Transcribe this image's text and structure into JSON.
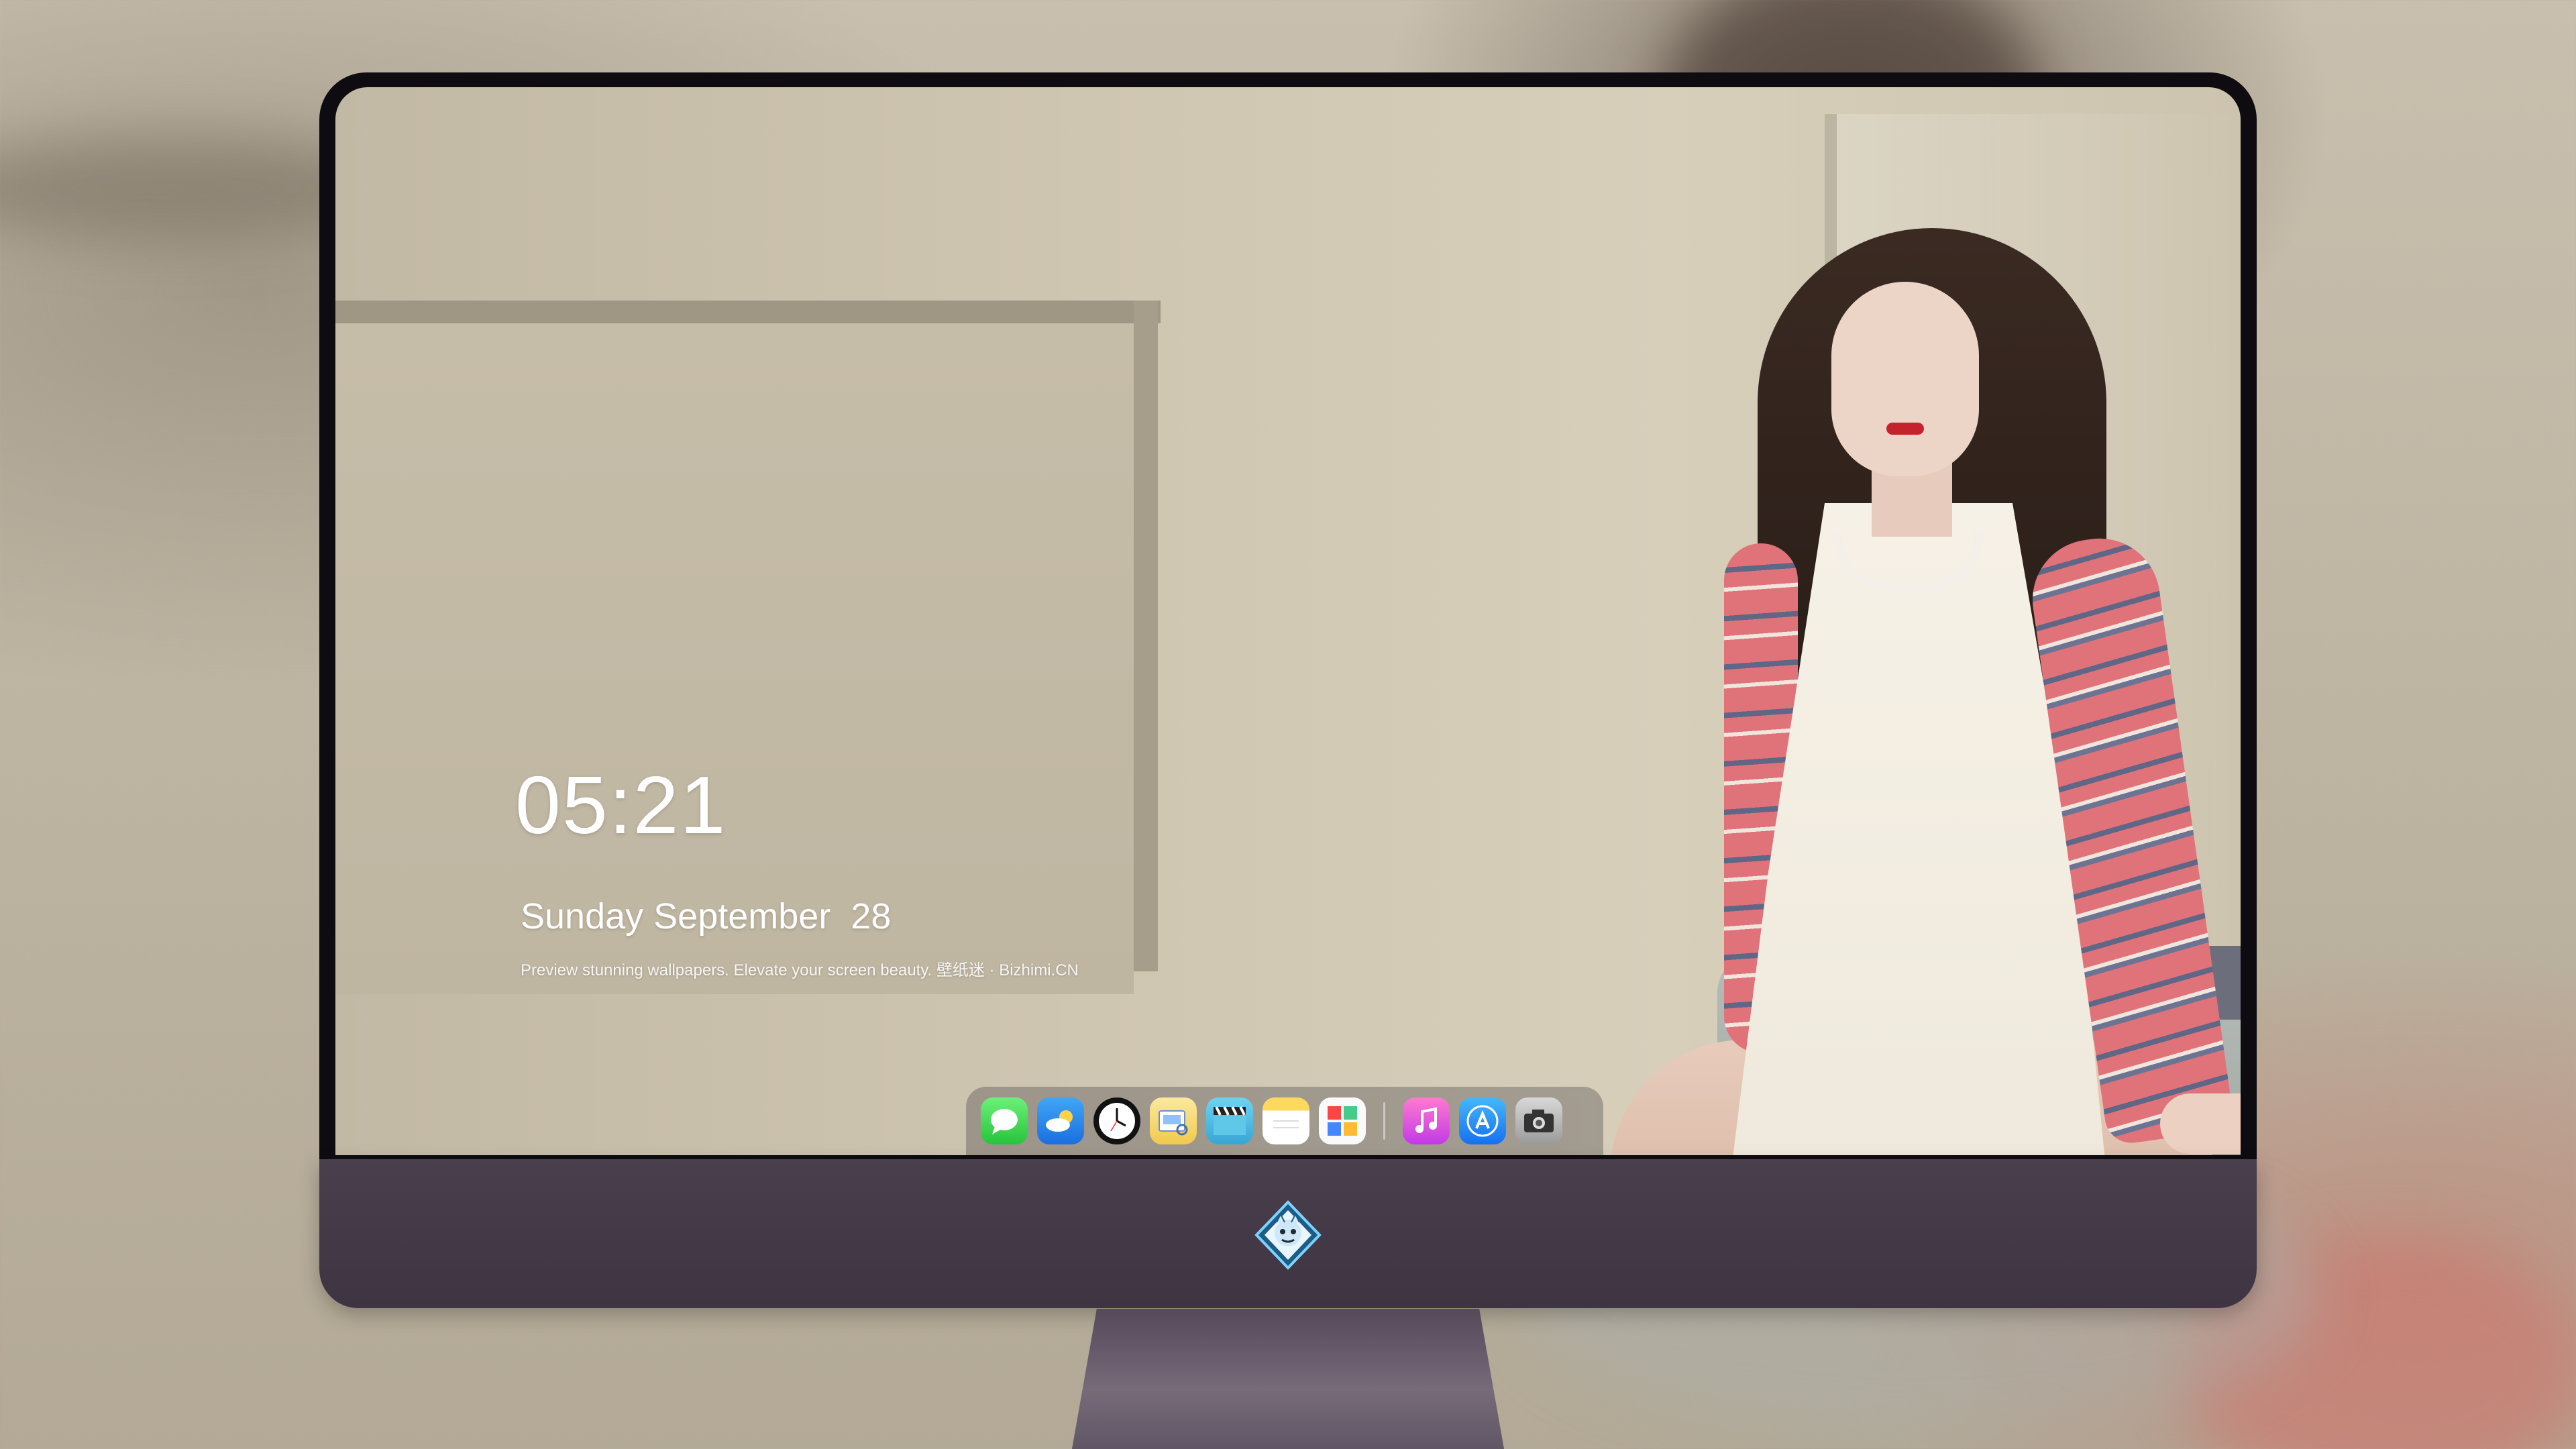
{
  "lock_screen": {
    "time": "05:21",
    "date": "Sunday September  28",
    "tagline": "Preview stunning wallpapers. Elevate your screen beauty. 壁纸迷 · Bizhimi.CN"
  },
  "dock": {
    "apps": [
      {
        "name": "Messages",
        "icon": "messages-icon"
      },
      {
        "name": "Weather",
        "icon": "weather-icon"
      },
      {
        "name": "Clock",
        "icon": "clock-icon"
      },
      {
        "name": "Preview",
        "icon": "preview-icon"
      },
      {
        "name": "Clips",
        "icon": "clips-icon"
      },
      {
        "name": "Notes",
        "icon": "notes-icon"
      },
      {
        "name": "Photo Booth",
        "icon": "photos-icon"
      },
      {
        "name": "Music",
        "icon": "music-icon"
      },
      {
        "name": "App Store",
        "icon": "app-store-icon"
      },
      {
        "name": "Camera",
        "icon": "camera-icon"
      }
    ]
  },
  "colors": {
    "chin": "#4a3f4c",
    "bezel": "#0e0c10",
    "text": "#ffffff"
  }
}
